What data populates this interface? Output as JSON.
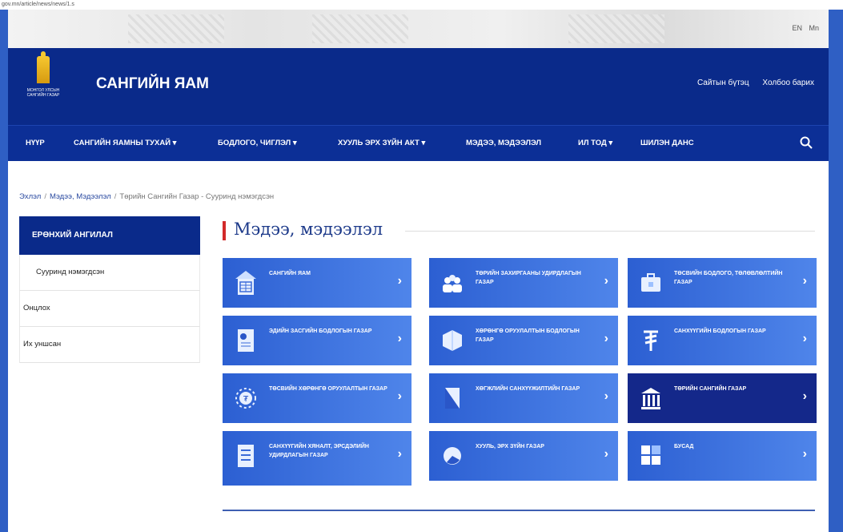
{
  "url": "gov.mn/article/news/news/1.s",
  "languages": [
    "EN",
    "Mn"
  ],
  "logo_text": "МОНГОЛ УЛСЫН САНГИЙН ГАЗАР",
  "site_title": "САНГИЙН ЯАМ",
  "top_links": [
    "Сайтын бүтэц",
    "Холбоо барих"
  ],
  "nav": [
    "НҮҮР",
    "САНГИЙН ЯАМНЫ ТУХАЙ ▾",
    "БОДЛОГО, ЧИГЛЭЛ ▾",
    "ХУУЛЬ ЭРХ ЗҮЙН АКТ ▾",
    "МЭДЭЭ, МЭДЭЭЛЭЛ",
    "ИЛ ТОД ▾",
    "ШИЛЭН ДАНС"
  ],
  "breadcrumb": {
    "home": "Эхлэл",
    "section": "Мэдээ, Мэдээлэл",
    "current": "Төрийн Сангийн Газар - Сууринд нэмэгдсэн"
  },
  "sidebar": {
    "heading": "ЕРӨНХИЙ АНГИЛАЛ",
    "items": [
      "Сууринд нэмэгдсэн",
      "Онцлох",
      "Их уншсан"
    ]
  },
  "section_title": "Мэдээ, мэдээлэл",
  "tiles": [
    {
      "label": "САНГИЙН ЯАМ",
      "icon": "building-icon"
    },
    {
      "label": "ТӨРИЙН ЗАХИРГААНЫ УДИРДЛАГЫН ГАЗАР",
      "icon": "people-icon"
    },
    {
      "label": "ТӨСВИЙН БОДЛОГО, ТӨЛӨВЛӨЛТИЙН ГАЗАР",
      "icon": "briefcase-icon"
    },
    {
      "label": "ЭДИЙН ЗАСГИЙН БОДЛОГЫН ГАЗАР",
      "icon": "chart-doc-icon"
    },
    {
      "label": "ХӨРӨНГӨ ОРУУЛАЛТЫН БОДЛОГЫН ГАЗАР",
      "icon": "cube-icon"
    },
    {
      "label": "САНХҮҮГИЙН БОДЛОГЫН ГАЗАР",
      "icon": "tugrik-icon"
    },
    {
      "label": "ТӨСВИЙН ХӨРӨНГӨ ОРУУЛАЛТЫН ГАЗАР",
      "icon": "gear-tugrik-icon"
    },
    {
      "label": "ХӨГЖЛИЙН САНХҮҮЖИЛТИЙН ГАЗАР",
      "icon": "document-icon"
    },
    {
      "label": "ТӨРИЙН САНГИЙН ГАЗАР",
      "icon": "columns-icon"
    },
    {
      "label": "САНХҮҮГИЙН ХЯНАЛТ, ЭРСДЭЛИЙН УДИРДЛАГЫН ГАЗАР",
      "icon": "list-icon"
    },
    {
      "label": "ХУУЛЬ, ЭРХ ЗҮЙН ГАЗАР",
      "icon": "globe-icon"
    },
    {
      "label": "БУСАД",
      "icon": "grid-icon"
    }
  ]
}
